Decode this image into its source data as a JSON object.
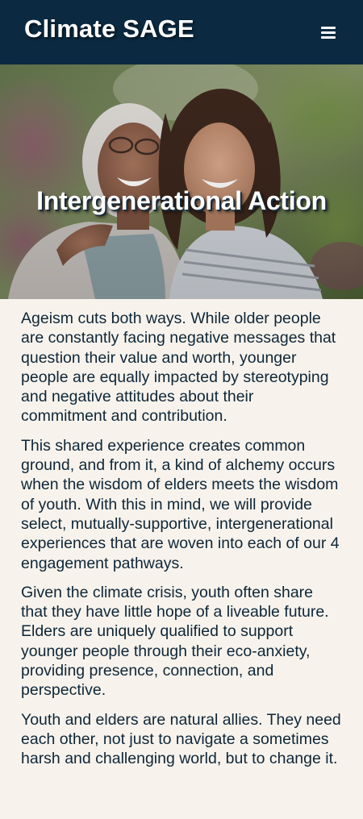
{
  "header": {
    "brand": "Climate SAGE",
    "menu_icon": "hamburger-menu-icon",
    "background": "#0b2a41"
  },
  "hero": {
    "title": "Intergenerational Action",
    "image_description": "older woman and younger woman embracing and smiling outdoors"
  },
  "content": {
    "paragraphs": [
      "Ageism cuts both ways. While older people are constantly facing negative messages that question their value and worth, younger people are equally impacted by stereotyping and negative attitudes about their commitment and contribution.",
      "This shared experience creates common ground, and from it, a kind of alchemy occurs when the wisdom of elders meets the wisdom of youth. With this in mind, we will provide select, mutually-supportive, intergenerational experiences that are woven into each of our 4 engagement pathways.",
      "Given the climate crisis, youth often share that they have little hope of a liveable future. Elders are uniquely qualified to support younger people through their eco-anxiety, providing presence, connection, and perspective.",
      "Youth and elders are natural allies. They need each other, not just to navigate a sometimes harsh and challenging world, but to change it."
    ]
  },
  "colors": {
    "header_bg": "#0b2a41",
    "page_bg": "#f7f3ec",
    "body_text": "#0e2638",
    "heading_text": "#ffffff"
  }
}
